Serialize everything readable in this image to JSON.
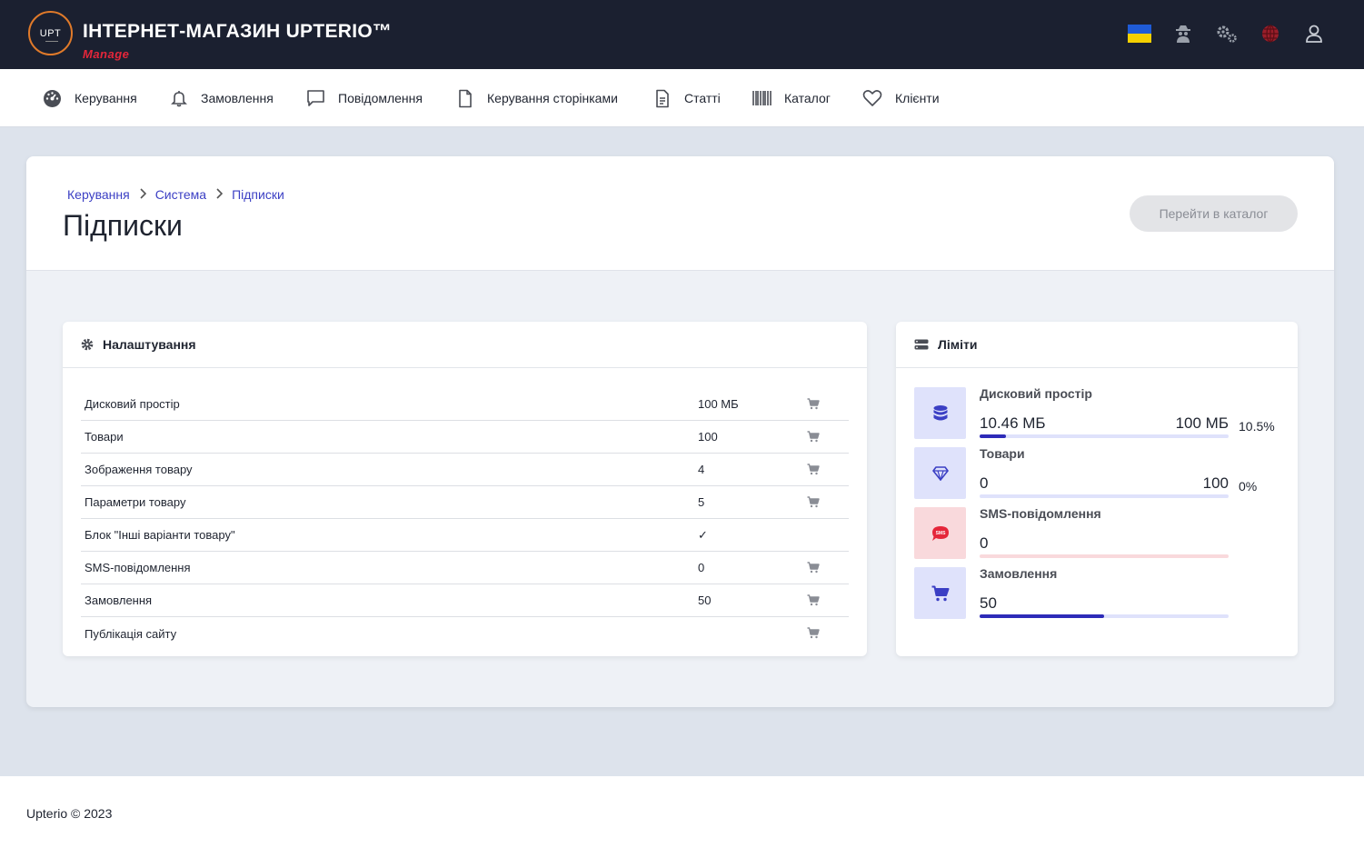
{
  "header": {
    "logo_text": "UPT",
    "title": "ІНТЕРНЕТ-МАГАЗИН UPTERIO™",
    "subtitle": "Manage",
    "icons": [
      "ukraine-flag-icon",
      "spy-icon",
      "gears-icon",
      "globe-icon",
      "user-icon"
    ]
  },
  "nav": {
    "items": [
      {
        "label": "Керування",
        "icon": "dashboard-icon"
      },
      {
        "label": "Замовлення",
        "icon": "bell-icon"
      },
      {
        "label": "Повідомлення",
        "icon": "message-icon"
      },
      {
        "label": "Керування сторінками",
        "icon": "page-icon"
      },
      {
        "label": "Статті",
        "icon": "article-icon"
      },
      {
        "label": "Каталог",
        "icon": "barcode-icon"
      },
      {
        "label": "Клієнти",
        "icon": "heart-icon"
      }
    ]
  },
  "page": {
    "breadcrumb": [
      "Керування",
      "Система",
      "Підписки"
    ],
    "title": "Підписки",
    "catalog_button": "Перейти в каталог"
  },
  "settings": {
    "title": "Налаштування",
    "rows": [
      {
        "label": "Дисковий простір",
        "value": "100 МБ",
        "cart": true
      },
      {
        "label": "Товари",
        "value": "100",
        "cart": true
      },
      {
        "label": "Зображення товару",
        "value": "4",
        "cart": true
      },
      {
        "label": "Параметри товару",
        "value": "5",
        "cart": true
      },
      {
        "label": "Блок \"Інші варіанти товару\"",
        "value": "✓",
        "cart": false
      },
      {
        "label": "SMS-повідомлення",
        "value": "0",
        "cart": true
      },
      {
        "label": "Замовлення",
        "value": "50",
        "cart": true
      },
      {
        "label": "Публікація сайту",
        "value": "",
        "cart": true
      }
    ]
  },
  "limits": {
    "title": "Ліміти",
    "items": [
      {
        "label": "Дисковий простір",
        "used": "10.46 МБ",
        "max": "100 МБ",
        "percent_text": "10.5%",
        "fill_fraction": 0.105,
        "icon": "database-icon",
        "color": "#3b3fc4",
        "bg": "#dfe2fb",
        "track": "#dfe2fb"
      },
      {
        "label": "Товари",
        "used": "0",
        "max": "100",
        "percent_text": "0%",
        "fill_fraction": 0,
        "icon": "diamond-icon",
        "color": "#3b3fc4",
        "bg": "#dfe2fb",
        "track": "#dfe2fb"
      },
      {
        "label": "SMS-повідомлення",
        "used": "0",
        "max": "",
        "percent_text": "",
        "fill_fraction": 0,
        "icon": "sms-icon",
        "color": "#e5263a",
        "bg": "#f9d9dc",
        "track": "#f9d9dc"
      },
      {
        "label": "Замовлення",
        "used": "50",
        "max": "",
        "percent_text": "",
        "fill_fraction": 0.5,
        "icon": "cart-icon",
        "color": "#3b3fc4",
        "bg": "#dfe2fb",
        "track": "#dfe2fb"
      }
    ]
  },
  "footer": {
    "text": "Upterio © 2023"
  },
  "colors": {
    "topbar": "#1b2030",
    "accent": "#3b3fc4",
    "brand_red": "#e5263a",
    "logo_ring": "#e07a2a"
  }
}
